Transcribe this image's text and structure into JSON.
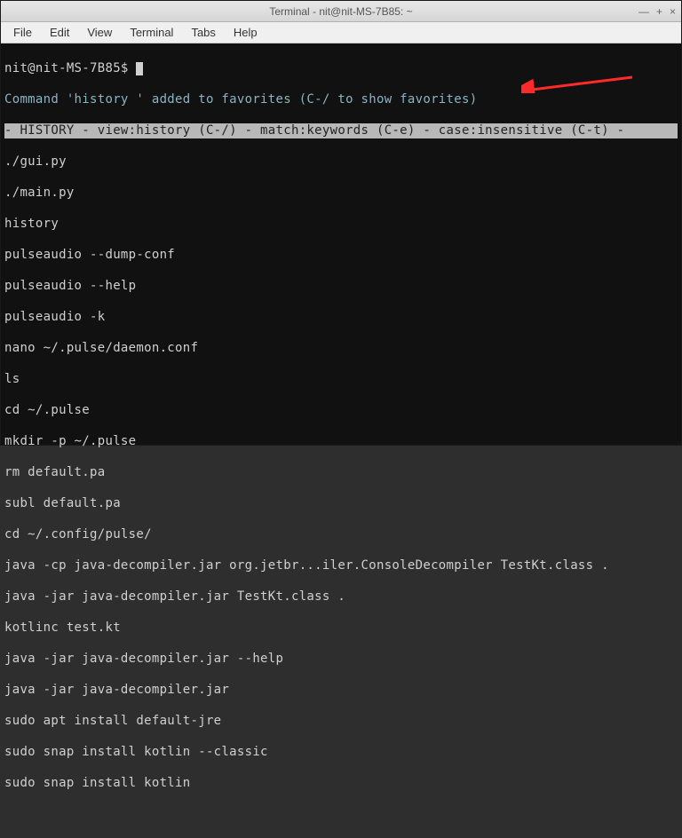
{
  "window": {
    "title": "Terminal - nit@nit-MS-7B85: ~"
  },
  "menubar": {
    "items": [
      "File",
      "Edit",
      "View",
      "Terminal",
      "Tabs",
      "Help"
    ]
  },
  "terminal": {
    "prompt": "nit@nit-MS-7B85$ ",
    "favorites_msg": "Command 'history ' added to favorites (C-/ to show favorites)",
    "header_bar": "- HISTORY - view:history (C-/) - match:keywords (C-e) - case:insensitive (C-t) -",
    "history": [
      "./gui.py",
      "./main.py",
      "history",
      "pulseaudio --dump-conf",
      "pulseaudio --help",
      "pulseaudio -k",
      "nano ~/.pulse/daemon.conf",
      "ls",
      "cd ~/.pulse",
      "mkdir -p ~/.pulse",
      "rm default.pa",
      "subl default.pa",
      "cd ~/.config/pulse/",
      "java -cp java-decompiler.jar org.jetbr...iler.ConsoleDecompiler TestKt.class .",
      "java -jar java-decompiler.jar TestKt.class .",
      "kotlinc test.kt",
      "java -jar java-decompiler.jar --help",
      "java -jar java-decompiler.jar",
      "sudo apt install default-jre",
      "sudo snap install kotlin --classic",
      "sudo snap install kotlin"
    ]
  },
  "annotation": {
    "arrow_color": "#ff2a2a"
  }
}
